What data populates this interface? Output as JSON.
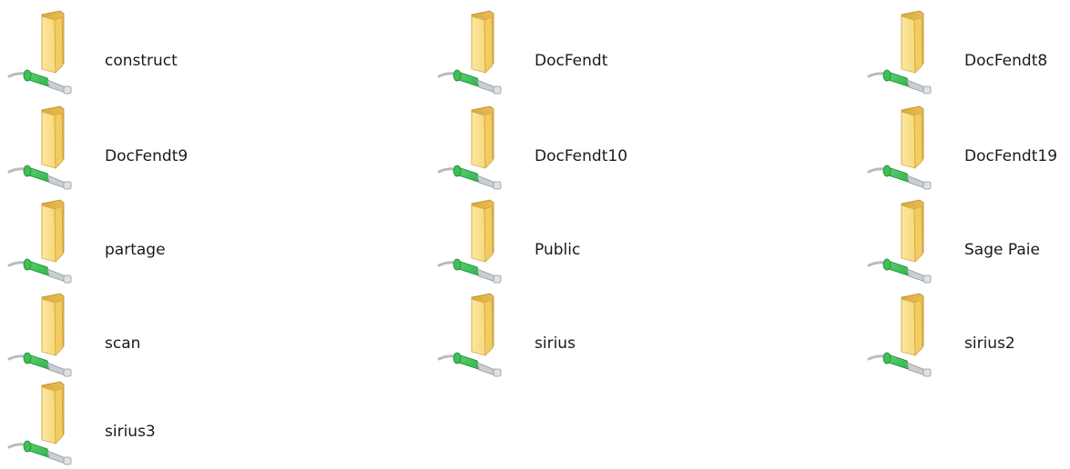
{
  "window": {
    "view": "network-shares-large-icons"
  },
  "colors": {
    "folder_back": "#d9a93b",
    "folder_front": "#f7d97a",
    "cable_green": "#2db34a",
    "plug_grey": "#c9ced3",
    "label_text": "#1a1a1a"
  },
  "icon": "network-folder-icon",
  "shares": [
    {
      "label": "construct"
    },
    {
      "label": "DocFendt"
    },
    {
      "label": "DocFendt8"
    },
    {
      "label": "DocFendt9"
    },
    {
      "label": "DocFendt10"
    },
    {
      "label": "DocFendt19"
    },
    {
      "label": "partage"
    },
    {
      "label": "Public"
    },
    {
      "label": "Sage Paie"
    },
    {
      "label": "scan"
    },
    {
      "label": "sirius"
    },
    {
      "label": "sirius2"
    },
    {
      "label": "sirius3"
    }
  ]
}
